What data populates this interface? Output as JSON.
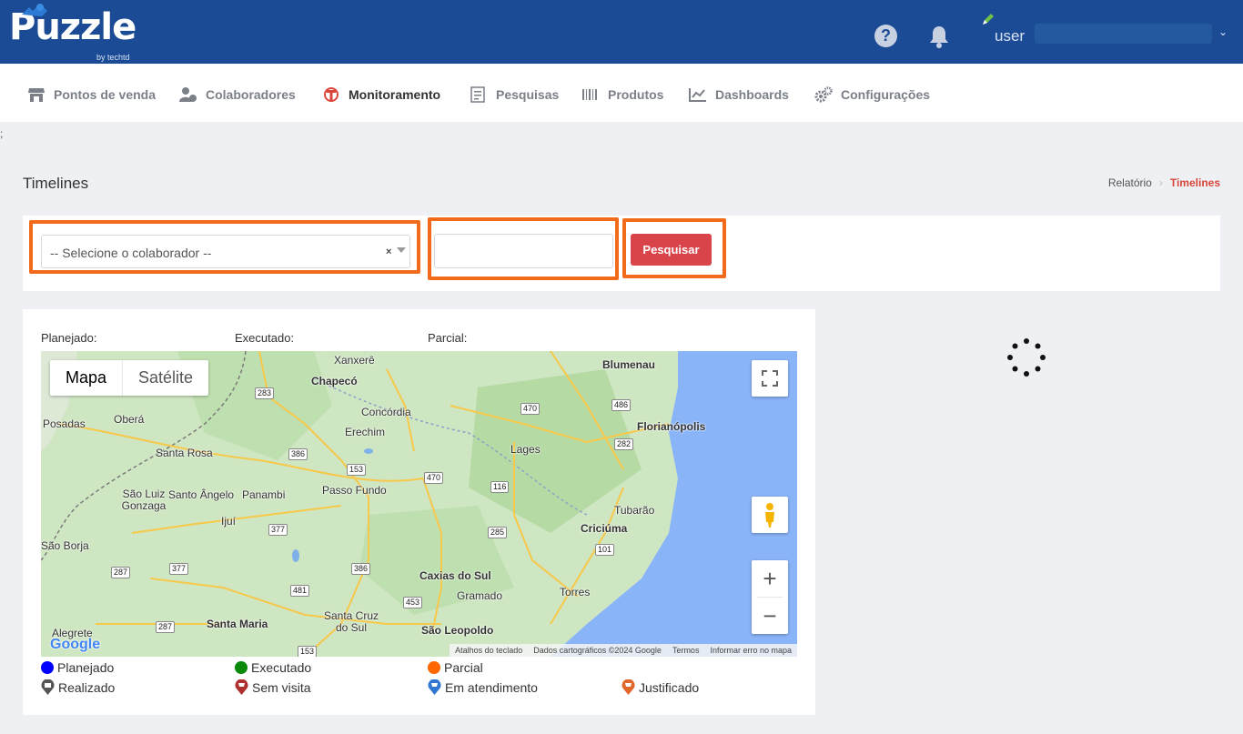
{
  "header": {
    "logo_text": "Puzzle",
    "logo_subtext": "by techtd",
    "help_icon": "question-circle-icon",
    "bell_icon": "bell-icon",
    "user_label": "user",
    "user_caret": "⌄"
  },
  "nav": {
    "items": [
      {
        "label": "Pontos de venda",
        "icon": "store-icon"
      },
      {
        "label": "Colaboradores",
        "icon": "users-icon"
      },
      {
        "label": "Monitoramento",
        "icon": "monitor-icon"
      },
      {
        "label": "Pesquisas",
        "icon": "survey-icon"
      },
      {
        "label": "Produtos",
        "icon": "barcode-icon"
      },
      {
        "label": "Dashboards",
        "icon": "chart-line-icon"
      },
      {
        "label": "Configurações",
        "icon": "gears-icon"
      }
    ],
    "active": "Monitoramento"
  },
  "stray_text": ";",
  "page": {
    "title": "Timelines",
    "breadcrumb": [
      "Relatório",
      "Timelines"
    ],
    "breadcrumb_sep": "›"
  },
  "filters": {
    "collaborator_placeholder": "-- Selecione o colaborador --",
    "clear_symbol": "×",
    "date_value": "",
    "search_button": "Pesquisar"
  },
  "map_panel": {
    "labels": {
      "planned": "Planejado:",
      "executed": "Executado:",
      "partial": "Parcial:"
    },
    "map_types": [
      "Mapa",
      "Satélite"
    ],
    "selected_map_type": "Mapa",
    "zoom_in": "+",
    "zoom_out": "−",
    "attribution": [
      "Atalhos do teclado",
      "Dados cartográficos ©2024 Google",
      "Termos",
      "Informar erro no mapa"
    ],
    "google_logo": "Google",
    "cities": [
      "Xanxerê",
      "Chapecó",
      "Blumenau",
      "Concórdia",
      "Posadas",
      "Oberá",
      "Erechim",
      "Florianópolis",
      "Lages",
      "Santa Rosa",
      "São Luiz Gonzaga",
      "Santo Ângelo",
      "Panambi",
      "Passo Fundo",
      "Ijuí",
      "Tubarão",
      "Criciúma",
      "São Borja",
      "Caxias do Sul",
      "Gramado",
      "Torres",
      "Santa Cruz do Sul",
      "Santa Maria",
      "São Leopoldo",
      "Alegrete"
    ],
    "highways": [
      "283",
      "470",
      "486",
      "282",
      "386",
      "153",
      "470",
      "116",
      "377",
      "285",
      "101",
      "287",
      "377",
      "386",
      "481",
      "453",
      "287",
      "153"
    ]
  },
  "legend": {
    "row1": [
      {
        "label": "Planejado",
        "color": "#0000ff"
      },
      {
        "label": "Executado",
        "color": "#0a8a0a"
      },
      {
        "label": "Parcial",
        "color": "#ff6600"
      }
    ],
    "row2": [
      {
        "label": "Realizado",
        "color": "#555555",
        "icon": "marker-store-icon"
      },
      {
        "label": "Sem visita",
        "color": "#b03030",
        "icon": "marker-cart-icon"
      },
      {
        "label": "Em atendimento",
        "color": "#2f77d0",
        "icon": "marker-cart-icon"
      },
      {
        "label": "Justificado",
        "color": "#e0662a",
        "icon": "marker-cart-icon"
      }
    ]
  },
  "colors": {
    "header_bg": "#1b4b95",
    "highlight": "#f26b1d",
    "button": "#d9434a",
    "breadcrumb_active": "#d9443b",
    "ocean": "#8ab4f8"
  }
}
